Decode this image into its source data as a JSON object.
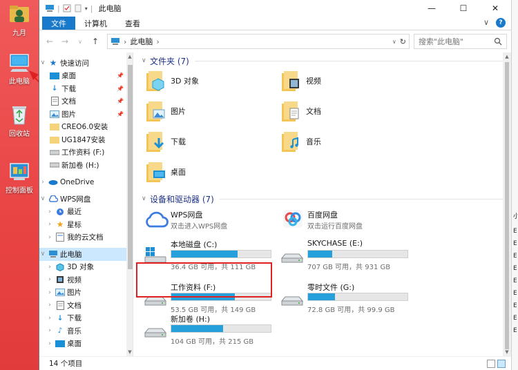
{
  "desktop": {
    "icons": [
      {
        "label": "九月"
      },
      {
        "label": "此电脑"
      },
      {
        "label": "回收站"
      },
      {
        "label": "控制面板"
      }
    ]
  },
  "window": {
    "title": "此电脑",
    "ribbon": {
      "tabs": [
        "文件",
        "计算机",
        "查看"
      ]
    },
    "address": {
      "path": "此电脑",
      "search_placeholder": "搜索\"此电脑\""
    },
    "nav": {
      "items": [
        {
          "label": "快速访问"
        },
        {
          "label": "桌面"
        },
        {
          "label": "下载"
        },
        {
          "label": "文档"
        },
        {
          "label": "图片"
        },
        {
          "label": "CREO6.0安装"
        },
        {
          "label": "UG1847安装"
        },
        {
          "label": "工作资料 (F:)"
        },
        {
          "label": "新加卷 (H:)"
        },
        {
          "label": "OneDrive"
        },
        {
          "label": "WPS网盘"
        },
        {
          "label": "最近"
        },
        {
          "label": "星标"
        },
        {
          "label": "我的云文档"
        },
        {
          "label": "此电脑"
        },
        {
          "label": "3D 对象"
        },
        {
          "label": "视频"
        },
        {
          "label": "图片"
        },
        {
          "label": "文档"
        },
        {
          "label": "下载"
        },
        {
          "label": "音乐"
        },
        {
          "label": "桌面"
        }
      ]
    },
    "folders_group": {
      "header": "文件夹 (7)",
      "items": [
        {
          "label": "3D 对象"
        },
        {
          "label": "视频"
        },
        {
          "label": "图片"
        },
        {
          "label": "文档"
        },
        {
          "label": "下载"
        },
        {
          "label": "音乐"
        },
        {
          "label": "桌面"
        }
      ]
    },
    "devices_group": {
      "header": "设备和驱动器 (7)",
      "clouds": [
        {
          "name": "WPS网盘",
          "sub": "双击进入WPS网盘"
        },
        {
          "name": "百度网盘",
          "sub": "双击运行百度网盘"
        }
      ],
      "drives": [
        {
          "name": "本地磁盘 (C:)",
          "free": "36.4 GB 可用，共 111 GB",
          "used_fraction": 0.67
        },
        {
          "name": "SKYCHASE (E:)",
          "free": "707 GB 可用，共 931 GB",
          "used_fraction": 0.24
        },
        {
          "name": "工作资料 (F:)",
          "free": "53.5 GB 可用，共 149 GB",
          "used_fraction": 0.64
        },
        {
          "name": "零时文件 (G:)",
          "free": "72.8 GB 可用，共 99.9 GB",
          "used_fraction": 0.27
        },
        {
          "name": "新加卷 (H:)",
          "free": "104 GB 可用，共 215 GB",
          "used_fraction": 0.52
        }
      ]
    },
    "status": {
      "count": "14 个项目"
    }
  },
  "background_window_glyphs": [
    "小",
    "E",
    "E",
    "E",
    "E",
    "E",
    "E",
    "E",
    "E",
    "E"
  ],
  "colors": {
    "accent": "#1979ca",
    "drive_bar": "#26a0da",
    "selection": "#cce8ff",
    "desktop": "#e94444",
    "annotation": "#e02020"
  }
}
